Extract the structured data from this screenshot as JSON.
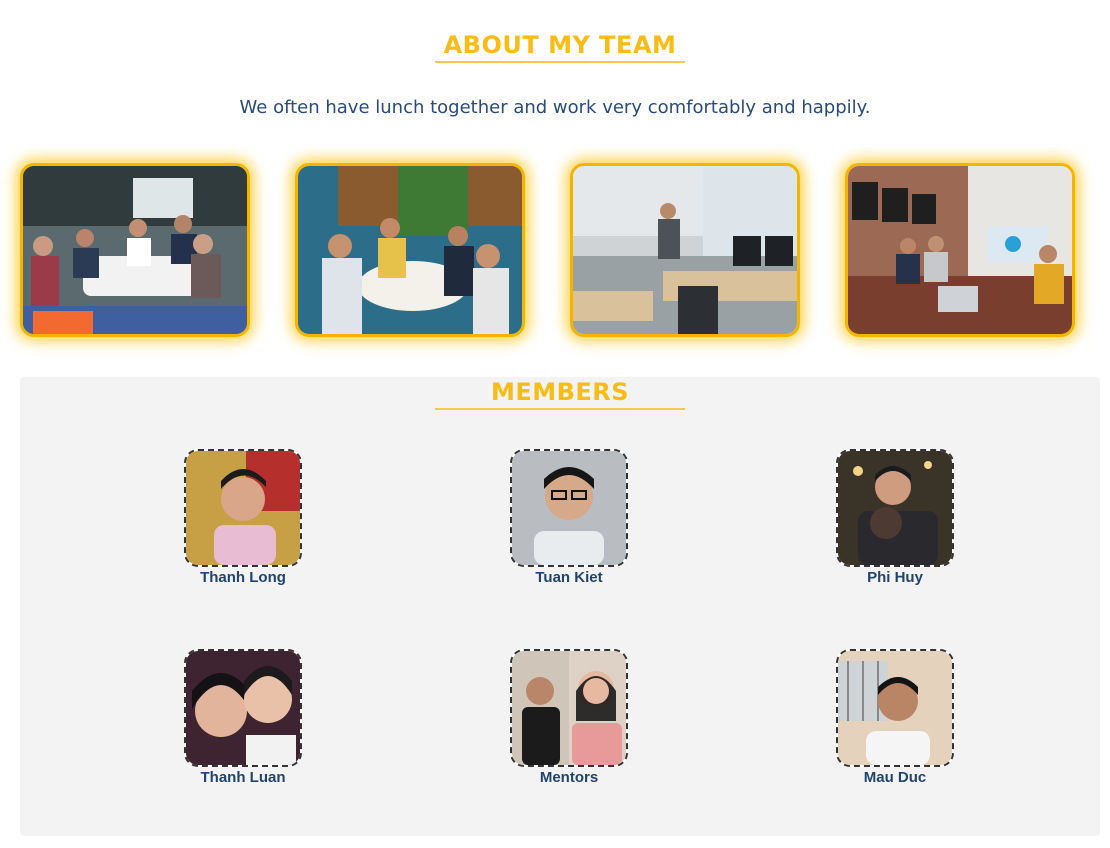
{
  "about": {
    "title": "ABOUT MY TEAM",
    "subtitle": "We often have lunch together and work very comfortably and happily."
  },
  "gallery": [
    {
      "alt": "team-lunch-photo"
    },
    {
      "alt": "team-meal-photo"
    },
    {
      "alt": "office-work-photo"
    },
    {
      "alt": "meeting-room-photo"
    }
  ],
  "members_section": {
    "title": "MEMBERS",
    "members": [
      {
        "name": "Thanh Long"
      },
      {
        "name": "Tuan Kiet"
      },
      {
        "name": "Phi Huy"
      },
      {
        "name": "Thanh Luan"
      },
      {
        "name": "Mentors"
      },
      {
        "name": "Mau Duc"
      }
    ]
  },
  "colors": {
    "accent": "#f8bc17",
    "text_blue": "#2b4a77",
    "panel_bg": "#f3f3f3"
  }
}
